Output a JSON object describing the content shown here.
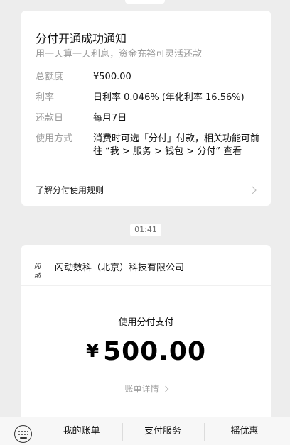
{
  "card_notice": {
    "title": "分付开通成功通知",
    "subtitle": "用一天算一天利息，资金充裕可灵活还款",
    "rows": [
      {
        "key": "总额度",
        "value": "¥500.00"
      },
      {
        "key": "利率",
        "value": "日利率 0.046% (年化利率 16.56%)"
      },
      {
        "key": "还款日",
        "value": "每月7日"
      },
      {
        "key": "使用方式",
        "value": "消费时可选「分付」付款，相关功能可前往 “我 > 服务 > 钱包 > 分付” 查看"
      }
    ],
    "link_label": "了解分付使用规则",
    "link_icon": "chevron-right-icon"
  },
  "timestamp": "01:41",
  "card_payment": {
    "merchant_logo_text": "闪动",
    "merchant_name": "闪动数科（北京）科技有限公司",
    "pay_method_label": "使用分付支付",
    "currency_symbol": "¥",
    "amount": "500.00",
    "detail_link_label": "账单详情",
    "detail_link_icon": "chevron-right-icon"
  },
  "bottom_menu": {
    "keyboard_icon": "keyboard-icon",
    "items": [
      {
        "label": "我的账单"
      },
      {
        "label": "支付服务"
      },
      {
        "label": "摇优惠"
      }
    ]
  },
  "colors": {
    "background": "#ededed",
    "card": "#ffffff",
    "primary_text": "#111111",
    "secondary_text": "#9a9a9a"
  }
}
